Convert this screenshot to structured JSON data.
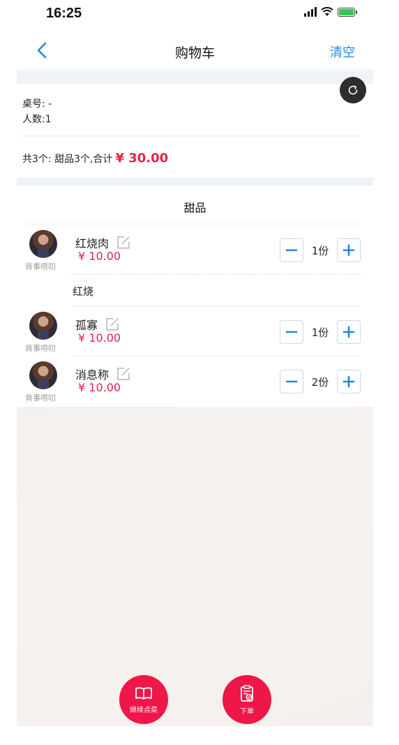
{
  "status": {
    "time": "16:25"
  },
  "nav": {
    "title": "购物车",
    "clear_label": "清空"
  },
  "info": {
    "table_label": "桌号:",
    "table_value": "-",
    "people_label": "人数:",
    "people_value": "1",
    "summary_text": "共3个: 甜品3个,合计",
    "summary_total": "¥ 30.00"
  },
  "section": {
    "title": "甜品"
  },
  "items": [
    {
      "name": "红烧肉",
      "price": "¥ 10.00",
      "qty": "1份",
      "avatar_caption": "背事唠叨",
      "note": "红烧"
    },
    {
      "name": "孤寡",
      "price": "¥ 10.00",
      "qty": "1份",
      "avatar_caption": "背事唠叨"
    },
    {
      "name": "消息称",
      "price": "¥ 10.00",
      "qty": "2份",
      "avatar_caption": "背事唠叨"
    }
  ],
  "actions": {
    "continue_label": "继续点菜",
    "order_label": "下单"
  },
  "colors": {
    "accent": "#1f87e8",
    "price": "#e8214a",
    "fab": "#ee1747"
  }
}
